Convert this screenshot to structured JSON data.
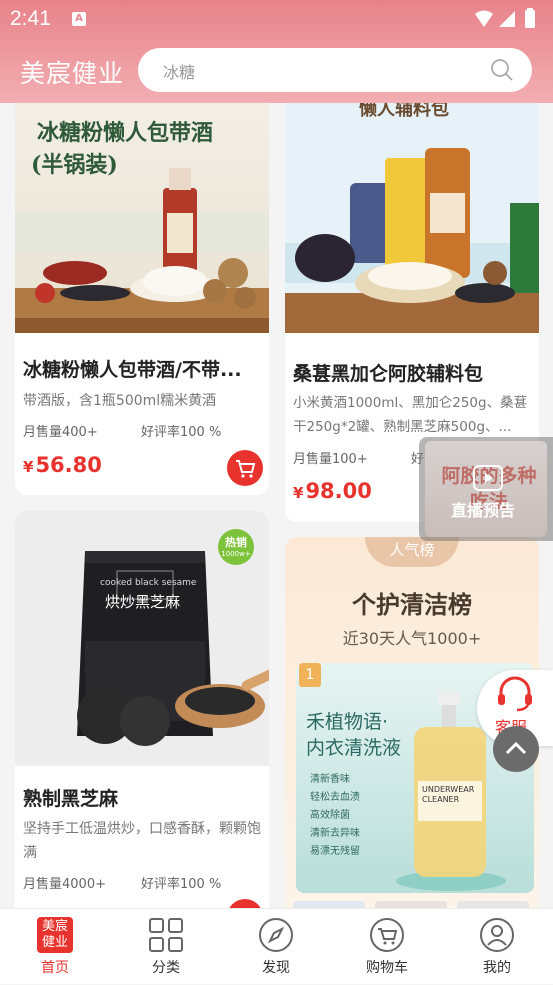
{
  "status_bar": {
    "time": "2:41"
  },
  "header": {
    "logo": "美宸健业",
    "search_placeholder": "冰糖"
  },
  "products": [
    {
      "img_title": "冰糖粉懒人包带酒",
      "img_sub": "(半锅装)",
      "title": "冰糖粉懒人包带酒/不带...",
      "desc": "带酒版，含1瓶500ml糯米黄酒",
      "sales": "月售量400+",
      "rating": "好评率100 %",
      "price": "56.80"
    },
    {
      "img_title": "懒人辅料包",
      "title": "桑葚黑加仑阿胶辅料包",
      "desc": "小米黄酒1000ml、黑加仑250g、桑葚干250g*2罐、熟制黑芝麻500g、...",
      "sales": "月售量100+",
      "rating": "好",
      "price": "98.00"
    },
    {
      "badge": "热销",
      "badge_sub": "1000w+",
      "bag_en": "cooked black sesame",
      "bag_cn": "烘炒黑芝麻",
      "title": "熟制黑芝麻",
      "desc": "坚持手工低温烘炒，口感香酥，颗颗饱满",
      "sales": "月售量4000+",
      "rating": "好评率100 %"
    }
  ],
  "ranking": {
    "tag": "人气榜",
    "title": "个护清洁榜",
    "subtitle": "近30天人气1000+",
    "rank": "1",
    "prod_line1": "禾植物语·",
    "prod_line2": "内衣清洗液",
    "bottle_text": "UNDERWEAR CLEANER",
    "features": [
      "清新香味",
      "轻松去血渍",
      "高效除菌",
      "清新去异味",
      "易漂无残留"
    ]
  },
  "floating": {
    "live": "直播预告",
    "live_bg": "阿胶的多种吃法",
    "service": "客服"
  },
  "currency": "¥",
  "tabbar": [
    {
      "label": "首页",
      "active": true,
      "icon": "home-logo-icon"
    },
    {
      "label": "分类",
      "icon": "grid-icon"
    },
    {
      "label": "发现",
      "icon": "compass-icon"
    },
    {
      "label": "购物车",
      "icon": "cart-icon"
    },
    {
      "label": "我的",
      "icon": "user-icon"
    }
  ],
  "colors": {
    "brand_red": "#e8322d",
    "header_pink": "#ee9da2",
    "tab_active": "#e8322d"
  }
}
